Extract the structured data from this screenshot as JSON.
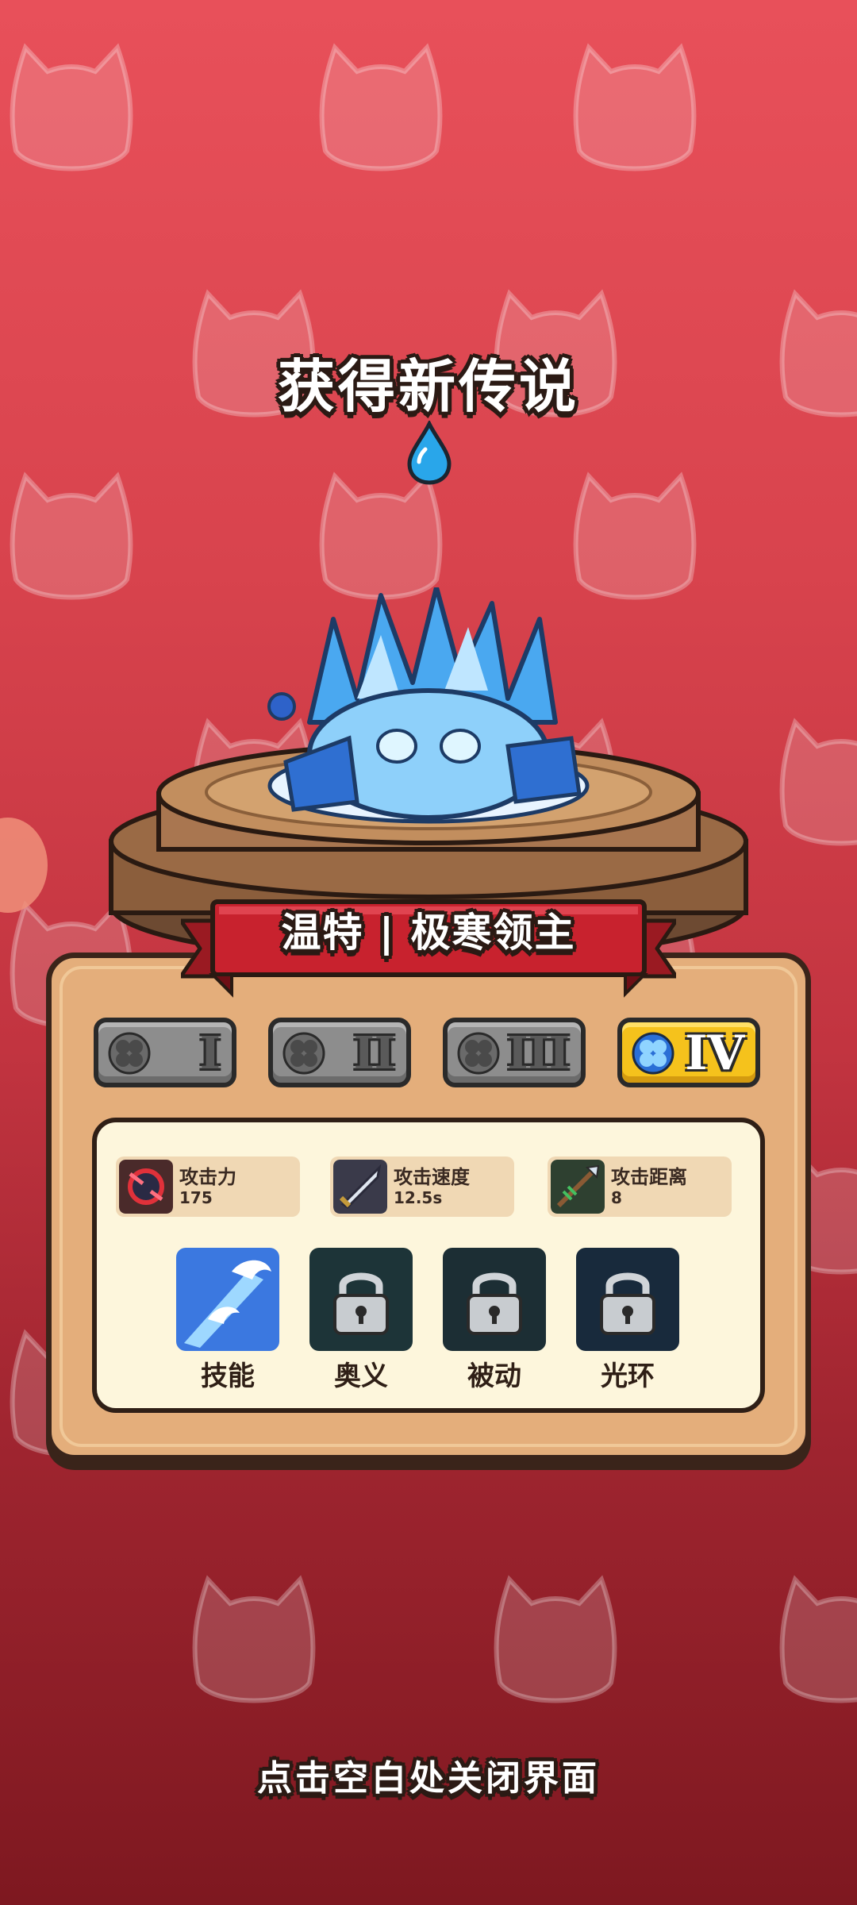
{
  "header": {
    "title": "获得新传说"
  },
  "element_icon": "water-drop-icon",
  "hero": {
    "name": "温特 | 极寒领主"
  },
  "tiers": [
    {
      "label": "I",
      "icon": "clover-icon",
      "active": false
    },
    {
      "label": "II",
      "icon": "clover-icon",
      "active": false
    },
    {
      "label": "III",
      "icon": "clover-icon",
      "active": false
    },
    {
      "label": "IV",
      "icon": "clover-icon",
      "active": true
    }
  ],
  "stats": [
    {
      "label": "攻击力",
      "value": "175",
      "icon": "attack-power-icon"
    },
    {
      "label": "攻击速度",
      "value": "12.5s",
      "icon": "attack-speed-icon"
    },
    {
      "label": "攻击距离",
      "value": "8",
      "icon": "attack-range-icon"
    }
  ],
  "skills": [
    {
      "label": "技能",
      "icon": "ice-skill-icon",
      "locked": false
    },
    {
      "label": "奥义",
      "icon": "lock-icon",
      "locked": true
    },
    {
      "label": "被动",
      "icon": "lock-icon",
      "locked": true
    },
    {
      "label": "光环",
      "icon": "lock-icon",
      "locked": true
    }
  ],
  "footer": {
    "hint": "点击空白处关闭界面"
  },
  "colors": {
    "background_top": "#e8505a",
    "background_bottom": "#7e1820",
    "panel": "#e4ae7b",
    "banner": "#c8222e",
    "active_tier": "#f5c21c",
    "inactive_tier": "#8d8d8d"
  }
}
